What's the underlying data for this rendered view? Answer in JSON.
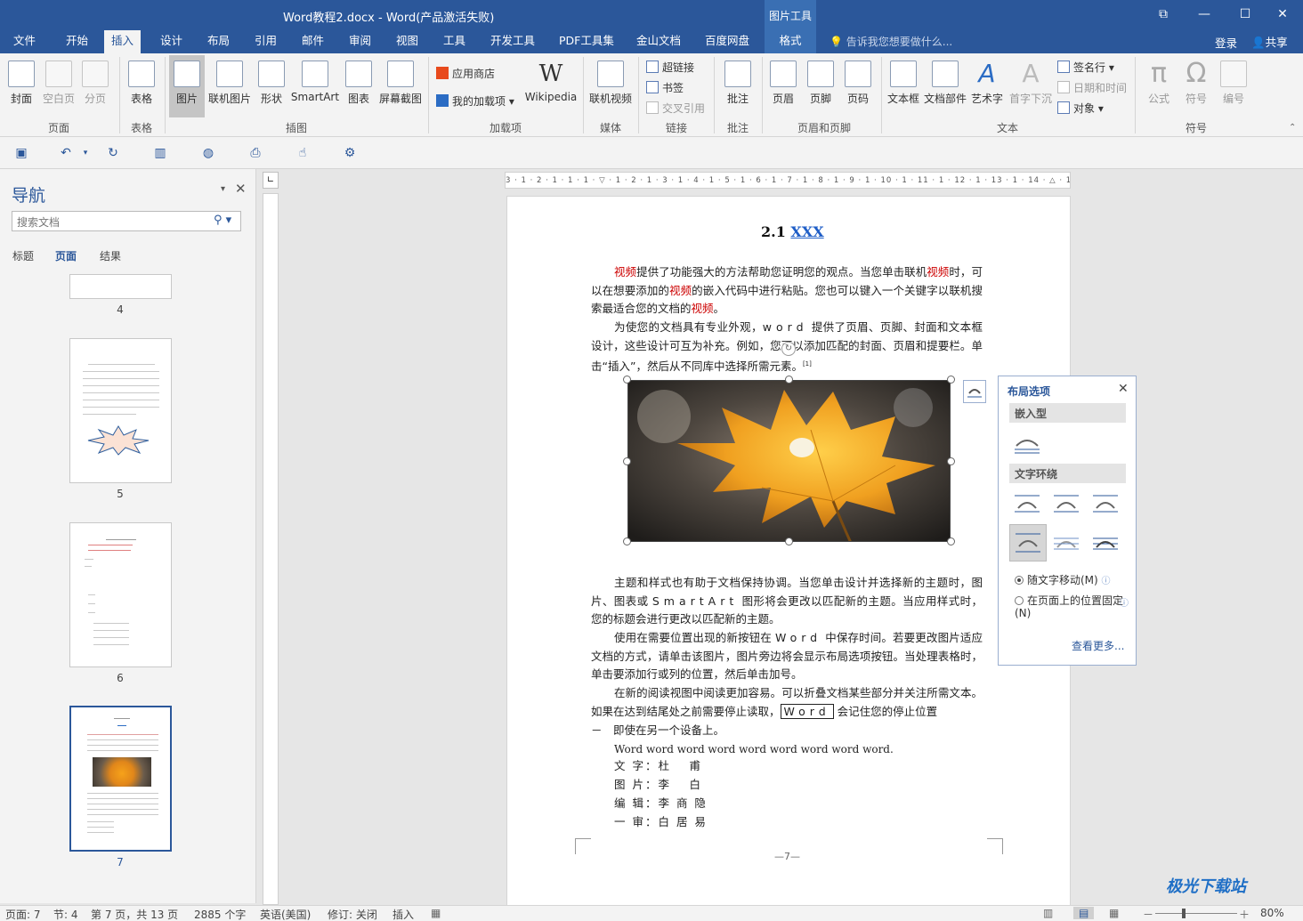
{
  "window": {
    "title": "Word教程2.docx - Word(产品激活失败)",
    "contextual_tab": "图片工具",
    "restore_icon": "restore-window-icon",
    "minimize": "—",
    "maximize": "☐",
    "close": "✕"
  },
  "tabs": [
    "文件",
    "开始",
    "插入",
    "设计",
    "布局",
    "引用",
    "邮件",
    "审阅",
    "视图",
    "工具",
    "开发工具",
    "PDF工具集",
    "金山文档",
    "百度网盘",
    "格式"
  ],
  "active_tab": "插入",
  "tellme": "告诉我您想要做什么...",
  "login": "登录",
  "share": "共享",
  "ribbon": {
    "groups": [
      "页面",
      "表格",
      "插图",
      "加载项",
      "媒体",
      "链接",
      "批注",
      "页眉和页脚",
      "文本",
      "符号"
    ],
    "pages": [
      "封面",
      "空白页",
      "分页"
    ],
    "table": "表格",
    "illustrations": [
      "图片",
      "联机图片",
      "形状",
      "SmartArt",
      "图表",
      "屏幕截图"
    ],
    "addins": {
      "store": "应用商店",
      "my_addins": "我的加载项",
      "wikipedia": "Wikipedia"
    },
    "media": "联机视频",
    "links": [
      "超链接",
      "书签",
      "交叉引用"
    ],
    "comment": "批注",
    "header_footer": [
      "页眉",
      "页脚",
      "页码"
    ],
    "text": [
      "文本框",
      "文档部件",
      "艺术字",
      "首字下沉"
    ],
    "text_small": [
      "签名行",
      "日期和时间",
      "对象"
    ],
    "symbols": [
      "公式",
      "符号",
      "编号"
    ]
  },
  "nav": {
    "title": "导航",
    "search_placeholder": "搜索文档",
    "tabs": [
      "标题",
      "页面",
      "结果"
    ],
    "active_tab": "页面",
    "pages": [
      "4",
      "5",
      "6",
      "7"
    ]
  },
  "ruler": "3 · 1 · 2 · 1 · 1 · 1 · ▽ · 1 · 2 · 1 · 3 · 1 · 4 · 1 · 5 · 1 · 6 · 1 · 7 · 1 · 8 · 1 · 9 · 1 · 10 · 1 · 11 · 1 · 12 · 1 · 13 · 1 · 14 · △ · 16 · 1 · 17 · 1",
  "document": {
    "heading_prefix": "2.1 ",
    "heading_link": "XXX",
    "p1_parts": [
      "视频",
      "提供了功能强大的方法帮助您证明您的观点。当您单击联机",
      "视频",
      "时，可以在想要添加的",
      "视频",
      "的嵌入代码中进行粘贴。您也可以键入一个关键字以联机搜索最适合您的文档的",
      "视频",
      "。"
    ],
    "p2": "为使您的文档具有专业外观，",
    "p2_word": "word",
    "p2_rest": "提供了页眉、页脚、封面和文本框设计，这些设计可互为补充。例如，您可以添加匹配的封面、页眉和提要栏。单击“插入”，然后从不同库中选择所需元素。",
    "p2_ref": "[1]",
    "p3a": "主题和样式也有助于文档保持协调。当您单击设计并选择新的主题时，图片、图表或",
    "p3_smartart": "SmartArt",
    "p3b": "图形将会更改以匹配新的主题。当应用样式时，您的标题会进行更改以匹配新的主题。",
    "p4a": "使用在需要位置出现的新按钮在",
    "p4_word": "Word",
    "p4b": "中保存时间。若要更改图片适应文档的方式，请单击该图片，图片旁边将会显示布局选项按钮。当处理表格时，单击要添加行或列的位置，然后单击加号。",
    "p5a": "在新的阅读视图中阅读更加容易。可以折叠文档某些部分并关注所需文本。如果在达到结尾处之前需要停止读取，",
    "p5_word": "Word",
    "p5b": "会记住您的停止位置",
    "p5c": "－　即使在另一个设备上。",
    "p6": "Word word word word word word word word word.",
    "credits": [
      "文 字：杜　 甫",
      "图 片：李　 白",
      "编 辑：李 商 隐",
      "一 审：白 居 易"
    ],
    "page_number": "—7—"
  },
  "layout_panel": {
    "title": "布局选项",
    "inline_section": "嵌入型",
    "wrap_section": "文字环绕",
    "move_with_text": "随文字移动(M)",
    "fix_position": "在页面上的位置固定(N)",
    "see_more": "查看更多..."
  },
  "status": {
    "page": "页面: 7",
    "section": "节: 4",
    "page_of": "第 7 页，共 13 页",
    "words": "2885 个字",
    "language": "英语(美国)",
    "track": "修订: 关闭",
    "insert": "插入",
    "zoom": "80%"
  },
  "watermark": "极光下载站",
  "colors": {
    "accent": "#2b579a",
    "highlight_red": "#c00000"
  }
}
